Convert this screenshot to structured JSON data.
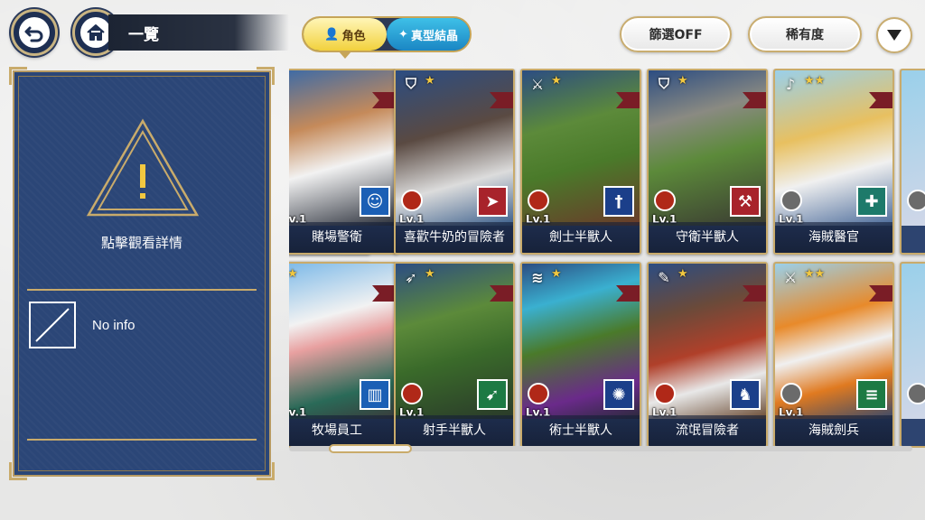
{
  "header": {
    "title": "一覽",
    "toggle": {
      "role_label": "角色",
      "crystal_label": "真型結晶"
    },
    "filter_label": "篩選OFF",
    "sort_label": "稀有度"
  },
  "panel": {
    "warning_text": "點擊觀看詳情",
    "no_info": "No info"
  },
  "colors": {
    "panel": "#2b4677",
    "gold": "#c9ab6b",
    "toggle_active": "#f2d13d",
    "toggle_inactive": "#1b86c4"
  },
  "cards": [
    {
      "name": "賭場警衛",
      "level": "Lv.1",
      "stars": "★",
      "class_icon": "axe-icon",
      "role_icon": "person-icon",
      "role_color": "#1b5fb5"
    },
    {
      "name": "喜歡牛奶的冒險者",
      "level": "Lv.1",
      "stars": "★",
      "class_icon": "shield-icon",
      "role_icon": "tackle-icon",
      "role_color": "#a8232b"
    },
    {
      "name": "劍士半獸人",
      "level": "Lv.1",
      "stars": "★",
      "class_icon": "sword-icon",
      "role_icon": "dagger-icon",
      "role_color": "#1b3f8a"
    },
    {
      "name": "守衛半獸人",
      "level": "Lv.1",
      "stars": "★",
      "class_icon": "shield-icon",
      "role_icon": "axe-icon",
      "role_color": "#a8232b"
    },
    {
      "name": "海賊醫官",
      "level": "Lv.1",
      "stars": "★★",
      "class_icon": "guitar-icon",
      "role_icon": "heal-icon",
      "role_color": "#1d7a6a"
    },
    {
      "name": "牧場員工",
      "level": "Lv.1",
      "stars": "★",
      "class_icon": "axe-icon",
      "role_icon": "milk-icon",
      "role_color": "#1b5fb5"
    },
    {
      "name": "射手半獸人",
      "level": "Lv.1",
      "stars": "★",
      "class_icon": "bow-icon",
      "role_icon": "arrow-icon",
      "role_color": "#1d7a44"
    },
    {
      "name": "術士半獸人",
      "level": "Lv.1",
      "stars": "★",
      "class_icon": "wave-icon",
      "role_icon": "magic-icon",
      "role_color": "#1b3f8a"
    },
    {
      "name": "流氓冒險者",
      "level": "Lv.1",
      "stars": "★",
      "class_icon": "feather-icon",
      "role_icon": "bag-icon",
      "role_color": "#1b3f8a"
    },
    {
      "name": "海賊劍兵",
      "level": "Lv.1",
      "stars": "★★",
      "class_icon": "sword-icon",
      "role_icon": "slash-icon",
      "role_color": "#1d7a44"
    }
  ]
}
